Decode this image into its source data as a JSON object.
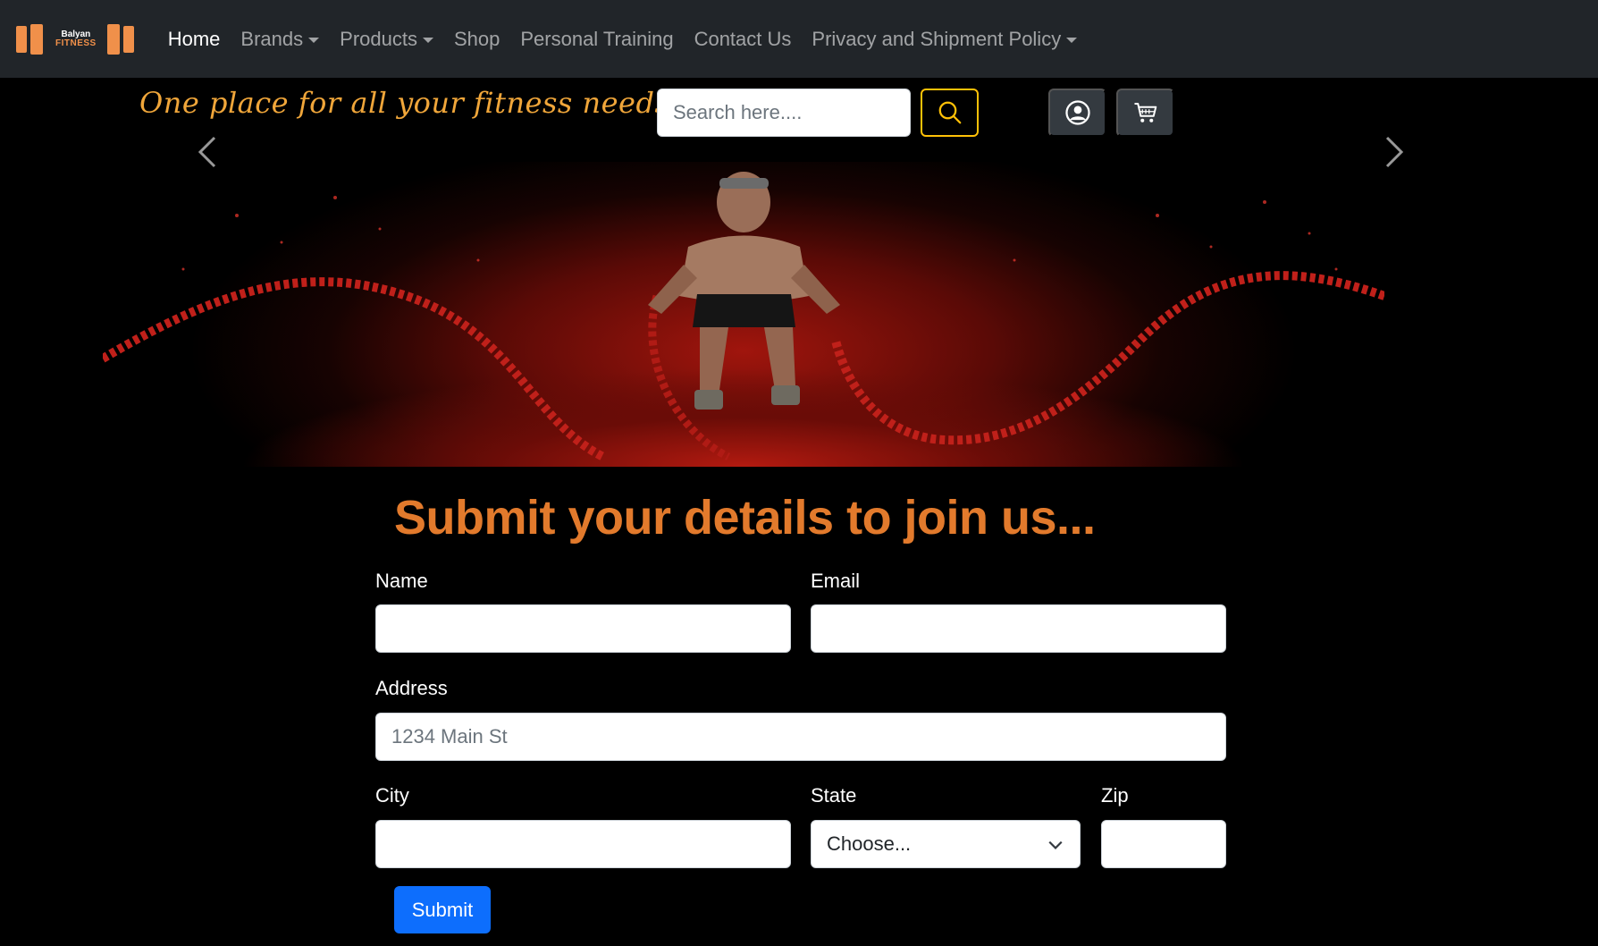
{
  "brand": {
    "line1": "Balyan",
    "line2": "FITNESS",
    "accent": "#f0904a"
  },
  "nav": {
    "items": [
      {
        "label": "Home",
        "active": true,
        "dropdown": false
      },
      {
        "label": "Brands",
        "active": false,
        "dropdown": true
      },
      {
        "label": "Products",
        "active": false,
        "dropdown": true
      },
      {
        "label": "Shop",
        "active": false,
        "dropdown": false
      },
      {
        "label": "Personal Training",
        "active": false,
        "dropdown": false
      },
      {
        "label": "Contact Us",
        "active": false,
        "dropdown": false
      },
      {
        "label": "Privacy and Shipment Policy",
        "active": false,
        "dropdown": true
      }
    ]
  },
  "header": {
    "tagline": "One place for all your fitness needs...",
    "search_placeholder": "Search here....",
    "icons": {
      "search": "search-icon",
      "account": "user-circle-icon",
      "cart": "cart-icon"
    }
  },
  "carousel": {
    "prev_icon": "chevron-left-icon",
    "next_icon": "chevron-right-icon"
  },
  "form": {
    "title": "Submit your details to join us...",
    "name_label": "Name",
    "email_label": "Email",
    "address_label": "Address",
    "address_placeholder": "1234 Main St",
    "city_label": "City",
    "state_label": "State",
    "state_selected": "Choose...",
    "zip_label": "Zip",
    "submit_label": "Submit"
  },
  "colors": {
    "navbar": "#212529",
    "title": "#e27a2c",
    "tagline": "#f0a63a",
    "submit": "#0d6efd",
    "search_border": "#ffc107"
  }
}
